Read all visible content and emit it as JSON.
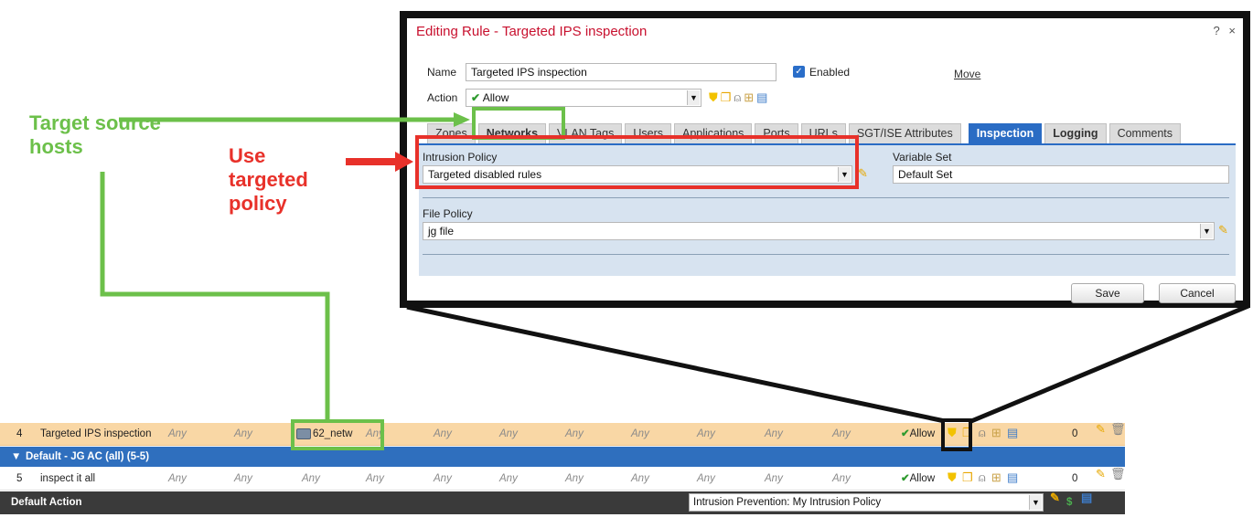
{
  "annotations": {
    "target_hosts": "Target source hosts",
    "use_policy": "Use targeted policy",
    "colors": {
      "green": "#6cc04a",
      "red": "#e8312a"
    }
  },
  "dialog": {
    "title": "Editing Rule - Targeted IPS inspection",
    "help": "?",
    "close": "×",
    "name_label": "Name",
    "name_value": "Targeted IPS inspection",
    "enabled_label": "Enabled",
    "move_link": "Move",
    "action_label": "Action",
    "action_value": "Allow",
    "tabs": [
      {
        "label": "Zones",
        "state": "normal"
      },
      {
        "label": "Networks",
        "state": "bold"
      },
      {
        "label": "VLAN Tags",
        "state": "normal"
      },
      {
        "label": "Users",
        "state": "normal"
      },
      {
        "label": "Applications",
        "state": "normal"
      },
      {
        "label": "Ports",
        "state": "normal"
      },
      {
        "label": "URLs",
        "state": "normal"
      },
      {
        "label": "SGT/ISE Attributes",
        "state": "normal"
      },
      {
        "label": "Inspection",
        "state": "active"
      },
      {
        "label": "Logging",
        "state": "bold"
      },
      {
        "label": "Comments",
        "state": "normal"
      }
    ],
    "intrusion_policy_label": "Intrusion Policy",
    "intrusion_policy_value": "Targeted disabled rules",
    "variable_set_label": "Variable Set",
    "variable_set_value": "Default Set",
    "file_policy_label": "File Policy",
    "file_policy_value": "jg file",
    "save": "Save",
    "cancel": "Cancel"
  },
  "table": {
    "rule4": {
      "num": "4",
      "name": "Targeted IPS inspection",
      "any": "Any",
      "network": "62_netw",
      "action": "Allow",
      "count": "0"
    },
    "section": {
      "label": "Default - JG AC (all) (5-5)",
      "caret": "▼"
    },
    "rule5": {
      "num": "5",
      "name": "inspect it all",
      "any": "Any",
      "action": "Allow",
      "count": "0"
    },
    "default_action": {
      "label": "Default Action",
      "value": "Intrusion Prevention: My Intrusion Policy",
      "dollar": "$"
    }
  }
}
